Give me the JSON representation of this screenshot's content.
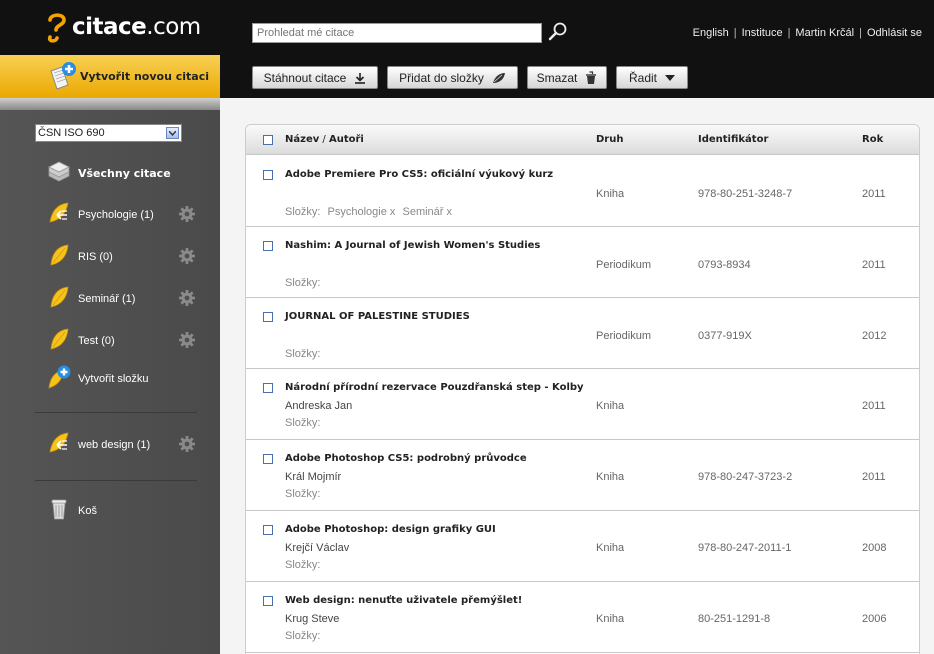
{
  "header": {
    "brand_bold": "citace",
    "brand_rest": ".com",
    "search_placeholder": "Prohledat mé citace",
    "links": {
      "english": "English",
      "institution": "Instituce",
      "user": "Martin Krčál",
      "logout": "Odhlásit se",
      "separator": "|"
    }
  },
  "create_citation_label": "Vytvořit novou citaci",
  "toolbar": {
    "download": "Stáhnout citace",
    "add_to_folder": "Přidat do složky",
    "delete": "Smazat",
    "sort": "Řadit"
  },
  "sidebar": {
    "style_value": "ČSN ISO 690",
    "all_citations": "Všechny citace",
    "folders": [
      {
        "label": "Psychologie (1)",
        "shared": true
      },
      {
        "label": "RIS (0)",
        "shared": false
      },
      {
        "label": "Seminář (1)",
        "shared": false
      },
      {
        "label": "Test (0)",
        "shared": false
      }
    ],
    "create_folder": "Vytvořit složku",
    "shared_folders": [
      {
        "label": "web design (1)"
      }
    ],
    "trash": "Koš"
  },
  "table": {
    "headers": {
      "title": "Název",
      "title_sep": " / ",
      "author": "Autoři",
      "type": "Druh",
      "identifier": "Identifikátor",
      "year": "Rok"
    },
    "folders_label": "Složky:",
    "rows": [
      {
        "title": "Adobe Premiere Pro CS5: oficiální výukový kurz",
        "author": "",
        "type": "Kniha",
        "identifier": "978-80-251-3248-7",
        "year": "2011",
        "folders": [
          "Psychologie",
          "Seminář"
        ]
      },
      {
        "title": "Nashim: A Journal of Jewish Women's Studies",
        "author": "",
        "type": "Periodikum",
        "identifier": "0793-8934",
        "year": "2011",
        "folders": []
      },
      {
        "title": "JOURNAL OF PALESTINE STUDIES",
        "author": "",
        "type": "Periodikum",
        "identifier": "0377-919X",
        "year": "2012",
        "folders": []
      },
      {
        "title": "Národní přírodní rezervace Pouzdřanská step - Kolby",
        "author": "Andreska Jan",
        "type": "Kniha",
        "identifier": "",
        "year": "2011",
        "folders": []
      },
      {
        "title": "Adobe Photoshop CS5: podrobný průvodce",
        "author": "Král Mojmír",
        "type": "Kniha",
        "identifier": "978-80-247-3723-2",
        "year": "2011",
        "folders": []
      },
      {
        "title": "Adobe Photoshop: design grafiky GUI",
        "author": "Krejčí Václav",
        "type": "Kniha",
        "identifier": "978-80-247-2011-1",
        "year": "2008",
        "folders": []
      },
      {
        "title": "Web design: nenuťte uživatele přemýšlet!",
        "author": "Krug Steve",
        "type": "Kniha",
        "identifier": "80-251-1291-8",
        "year": "2006",
        "folders": []
      }
    ]
  }
}
